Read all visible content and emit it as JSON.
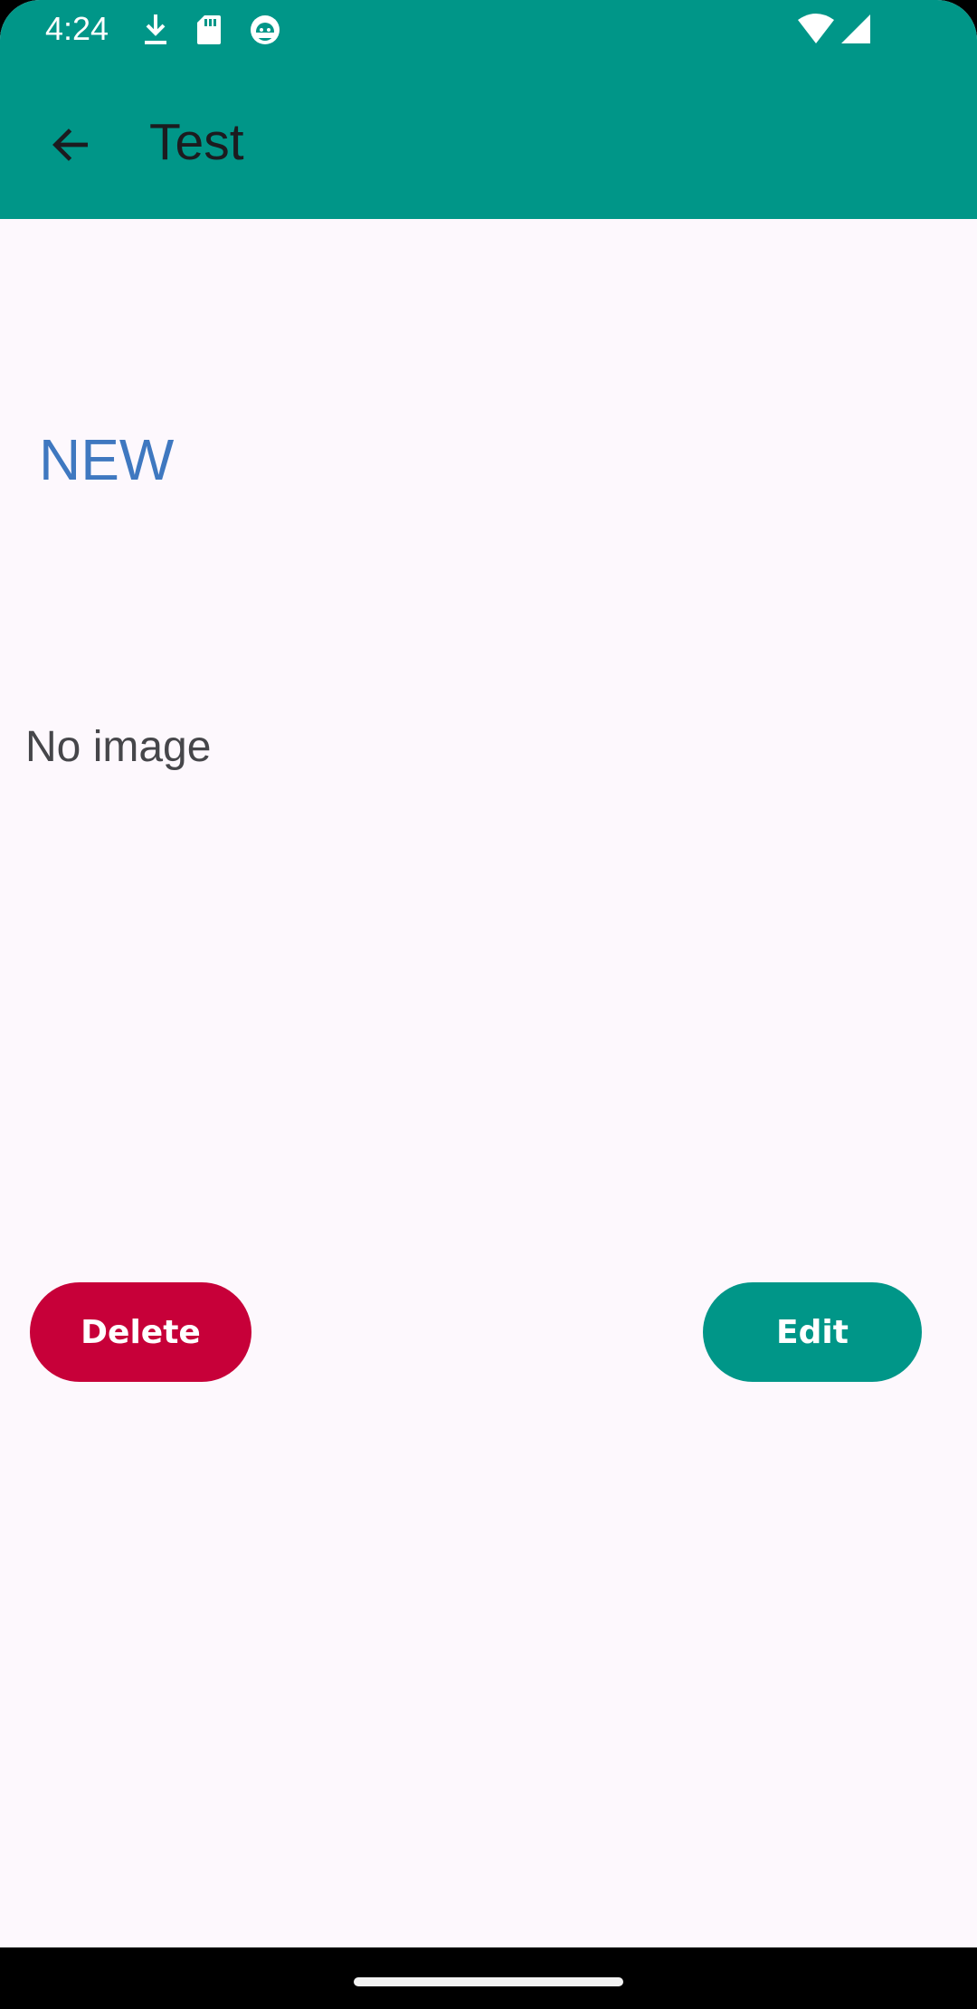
{
  "status_bar": {
    "time": "4:24",
    "icons_left": [
      "download-icon",
      "sd-card-icon",
      "android-debug-icon"
    ],
    "icons_right": [
      "wifi-icon",
      "signal-icon"
    ]
  },
  "app_bar": {
    "title": "Test",
    "back_icon": "arrow-back-icon",
    "background_color": "#009688"
  },
  "detail": {
    "status_label": "NEW",
    "status_color": "#3F78C0",
    "image_placeholder": "No image"
  },
  "actions": {
    "delete_label": "Delete",
    "delete_color": "#C70039",
    "edit_label": "Edit",
    "edit_color": "#009688"
  }
}
